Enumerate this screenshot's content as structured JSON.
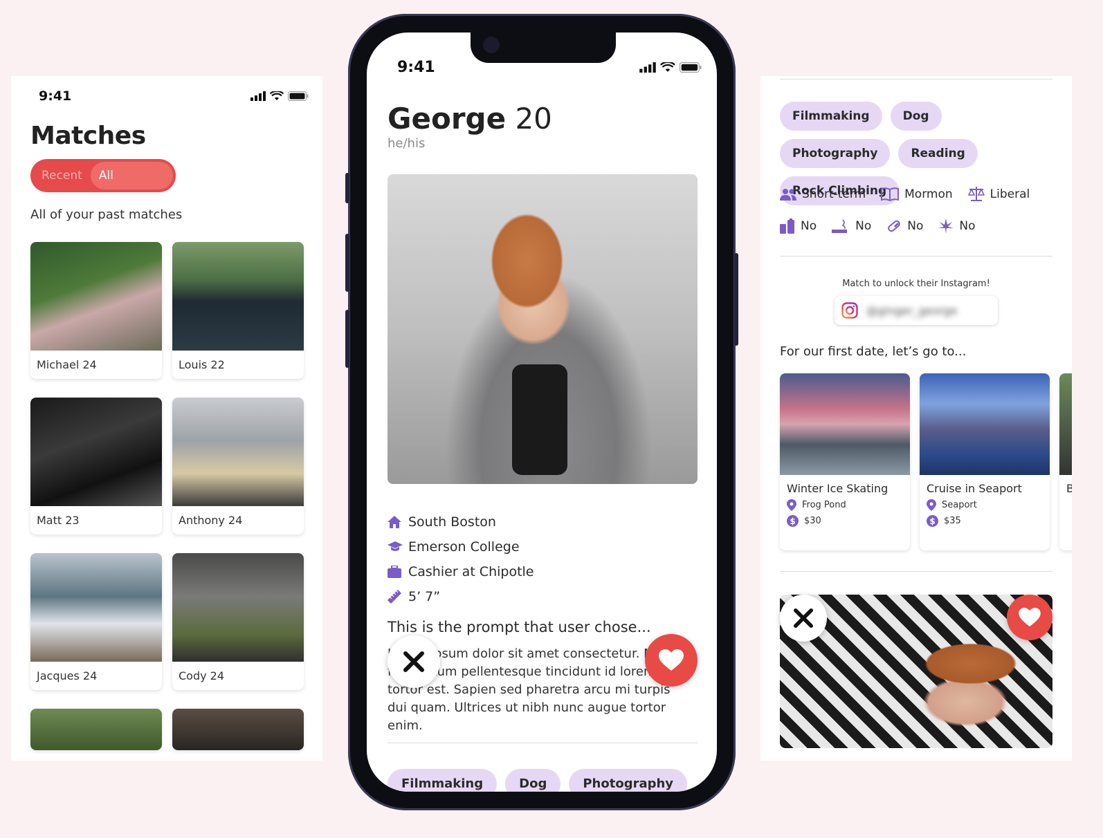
{
  "colors": {
    "accent_red": "#e64a4a",
    "tag_bg": "#e6d8f5",
    "icon_purple": "#7a5cc7",
    "background": "#fcf1f2"
  },
  "status_bar": {
    "time": "9:41"
  },
  "matches_screen": {
    "title": "Matches",
    "toggle": {
      "recent": "Recent",
      "all": "All Matches",
      "selected": "All Matches"
    },
    "subtitle": "All of your past matches",
    "cards": [
      {
        "name": "Michael 24"
      },
      {
        "name": "Louis 22"
      },
      {
        "name": "Matt 23"
      },
      {
        "name": "Anthony 24"
      },
      {
        "name": "Jacques 24"
      },
      {
        "name": "Cody 24"
      }
    ]
  },
  "profile_screen": {
    "name": "George",
    "age": "20",
    "pronouns": "he/his",
    "info": {
      "location": "South Boston",
      "school": "Emerson College",
      "job": "Cashier at Chipotle",
      "height": "5’ 7”"
    },
    "prompt": "This is the prompt that user chose...",
    "prompt_answer": "Lorem ipsum dolor sit amet consectetur. Nunc fermentum pellentesque tincidunt id lorem tortor est. Sapien sed pharetra arcu mi turpis dui quam. Ultrices ut nibh nunc augue tortor enim.",
    "interests": [
      "Filmmaking",
      "Dog",
      "Photography"
    ]
  },
  "details_screen": {
    "interests": [
      "Filmmaking",
      "Dog",
      "Photography",
      "Reading",
      "Rock Climbing"
    ],
    "attributes": {
      "relationship": "Short-term",
      "religion": "Mormon",
      "politics": "Liberal",
      "drinking": "No",
      "smoking": "No",
      "drugs": "No",
      "cannabis": "No"
    },
    "instagram_note": "Match to unlock their Instagram!",
    "instagram_handle": "@ginger_george",
    "date_heading": "For our first date, let’s go to...",
    "dates": [
      {
        "title": "Winter Ice Skating",
        "location": "Frog Pond",
        "price": "$30"
      },
      {
        "title": "Cruise in Seaport",
        "location": "Seaport",
        "price": "$35"
      },
      {
        "title": "B"
      }
    ]
  }
}
